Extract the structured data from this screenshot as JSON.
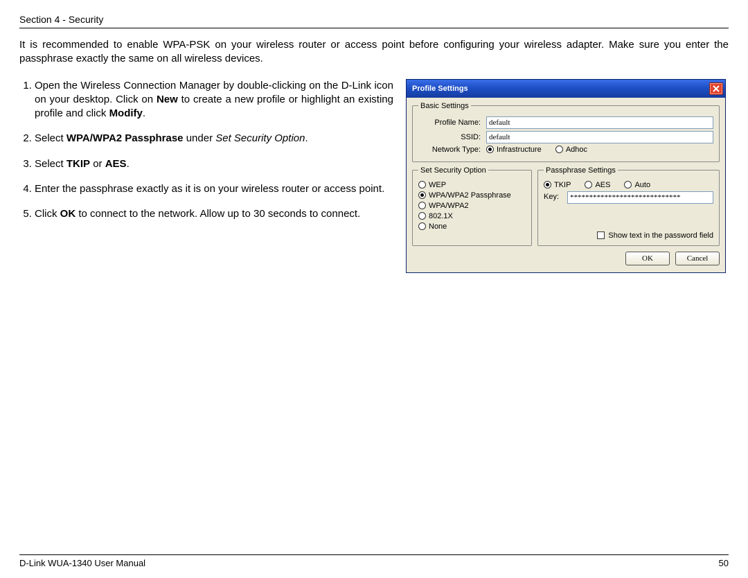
{
  "header": "Section 4 - Security",
  "intro": "It is recommended to enable WPA-PSK on your wireless router or access point before configuring your wireless adapter. Make sure you enter the passphrase exactly the same on all wireless devices.",
  "steps": {
    "s1a": "Open the Wireless Connection Manager by double-clicking on the D-Link icon on your desktop. Click on ",
    "s1b_new": "New",
    "s1c": " to create a new profile or highlight an existing profile and click ",
    "s1d_modify": "Modify",
    "s1e": ".",
    "s2a": "Select ",
    "s2b_wpa": "WPA/WPA2 Passphrase",
    "s2c": " under ",
    "s2d_sso": "Set Security Option",
    "s2e": ".",
    "s3a": "Select ",
    "s3b_tkip": "TKIP",
    "s3c": " or ",
    "s3d_aes": "AES",
    "s3e": ".",
    "s4": "Enter the passphrase exactly as it is on your wireless router or access point.",
    "s5a": "Click ",
    "s5b_ok": "OK",
    "s5c": " to connect to the network. Allow up to 30 seconds to connect."
  },
  "dialog": {
    "title": "Profile Settings",
    "basic_legend": "Basic Settings",
    "profile_name_label": "Profile Name:",
    "profile_name_value": "default",
    "ssid_label": "SSID:",
    "ssid_value": "default",
    "network_type_label": "Network Type:",
    "infra_label": "Infrastructure",
    "adhoc_label": "Adhoc",
    "sec_legend": "Set Security Option",
    "sec_wep": "WEP",
    "sec_wpapass": "WPA/WPA2 Passphrase",
    "sec_wpa": "WPA/WPA2",
    "sec_8021x": "802.1X",
    "sec_none": "None",
    "pass_legend": "Passphrase Settings",
    "tkip": "TKIP",
    "aes": "AES",
    "auto": "Auto",
    "key_label": "Key:",
    "key_value": "*****************************",
    "show_text": "Show text in the password field",
    "ok": "OK",
    "cancel": "Cancel"
  },
  "footer": {
    "left": "D-Link WUA-1340 User Manual",
    "right": "50"
  }
}
